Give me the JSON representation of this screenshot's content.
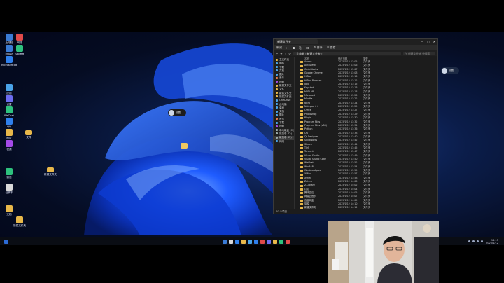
{
  "desktop": {
    "icons_left": [
      {
        "label": "此电脑"
      },
      {
        "label": "网络"
      },
      {
        "label": "回收站"
      },
      {
        "label": "控制面板"
      },
      {
        "label": "Microsoft Edge"
      },
      {
        "label": "应用"
      },
      {
        "label": "设置"
      },
      {
        "label": "WeChat"
      },
      {
        "label": "QQ"
      },
      {
        "label": "图片"
      },
      {
        "label": "视频"
      },
      {
        "label": "微信"
      },
      {
        "label": "记事本"
      },
      {
        "label": "文档"
      },
      {
        "label": "新建文件夹"
      }
    ],
    "folder_icons": [
      {
        "label": "文件"
      },
      {
        "label": "新建文件夹"
      },
      {
        "label": ""
      }
    ],
    "profile_badge": "设置",
    "right_badge": "设置"
  },
  "explorer": {
    "tab_title": "新建文件夹",
    "window_controls": [
      "—",
      "□",
      "✕"
    ],
    "toolbar": [
      "新建",
      "✂",
      "⧉",
      "⎘",
      "⌫",
      "⇅ 排序",
      "☰ 查看",
      "···"
    ],
    "breadcrumb": "› 此电脑 › 新建文件夹 ›",
    "search_placeholder": "在 新建文件夹 中搜索",
    "nav_items": [
      {
        "label": "主文件夹",
        "color": "#e8b84a"
      },
      {
        "label": "图库",
        "color": "#4aa3e8"
      },
      {
        "label": "下载",
        "color": "#4aa3e8"
      },
      {
        "label": "文档",
        "color": "#4aa3e8"
      },
      {
        "label": "图片",
        "color": "#4aa3e8"
      },
      {
        "label": "音乐",
        "color": "#e87a4a"
      },
      {
        "label": "视频",
        "color": "#a44ae8"
      },
      {
        "label": "新建文件夹",
        "color": "#e8b84a"
      },
      {
        "label": "文件",
        "color": "#e8b84a"
      },
      {
        "label": "新建文件夹",
        "color": "#e8b84a"
      },
      {
        "label": "新建文件夹",
        "color": "#e8b84a"
      },
      {
        "label": "OneDrive",
        "color": "#4aa3e8"
      },
      {
        "label": "此电脑",
        "color": "#4aa3e8"
      },
      {
        "label": "桌面",
        "color": "#4aa3e8"
      },
      {
        "label": "文档",
        "color": "#4aa3e8"
      },
      {
        "label": "图片",
        "color": "#4aa3e8"
      },
      {
        "label": "音乐",
        "color": "#e87a4a"
      },
      {
        "label": "下载",
        "color": "#4aa3e8"
      },
      {
        "label": "视频",
        "color": "#a44ae8"
      },
      {
        "label": "本地磁盘 (C:)",
        "color": "#9aa"
      },
      {
        "label": "新加卷 (D:)",
        "color": "#9aa"
      },
      {
        "label": "新加卷 (E:)",
        "color": "#9aa"
      },
      {
        "label": "网络",
        "color": "#4aa3e8"
      }
    ],
    "columns": [
      "名称",
      "修改日期",
      "类型"
    ],
    "files": [
      {
        "name": "Adobe",
        "date": "2025/1/12 13:05",
        "type": "文件夹"
      },
      {
        "name": "AutoDesk",
        "date": "2025/1/12 13:06",
        "type": "文件夹"
      },
      {
        "name": "CodeBlocks",
        "date": "2025/1/12 13:07",
        "type": "文件夹"
      },
      {
        "name": "Google Chrome",
        "date": "2025/1/12 13:08",
        "type": "文件夹"
      },
      {
        "name": "HiTool",
        "date": "2025/1/12 13:10",
        "type": "文件夹"
      },
      {
        "name": "HiTool Browser",
        "date": "2025/1/12 13:12",
        "type": "文件夹"
      },
      {
        "name": "Java",
        "date": "2025/1/12 13:15",
        "type": "文件夹"
      },
      {
        "name": "Keyshot",
        "date": "2025/1/12 13:16",
        "type": "文件夹"
      },
      {
        "name": "MATLAB",
        "date": "2025/1/12 13:18",
        "type": "文件夹"
      },
      {
        "name": "Microsoft",
        "date": "2025/1/12 13:20",
        "type": "文件夹"
      },
      {
        "name": "Mozilla",
        "date": "2025/1/12 13:22",
        "type": "文件夹"
      },
      {
        "name": "Nitro",
        "date": "2025/1/12 13:24",
        "type": "文件夹"
      },
      {
        "name": "Notepad++",
        "date": "2025/1/12 13:25",
        "type": "文件夹"
      },
      {
        "name": "Office",
        "date": "2025/1/12 13:27",
        "type": "文件夹"
      },
      {
        "name": "Photoshop",
        "date": "2025/1/12 13:29",
        "type": "文件夹"
      },
      {
        "name": "Plugin",
        "date": "2025/1/12 13:30",
        "type": "文件夹"
      },
      {
        "name": "Program Files",
        "date": "2025/1/12 13:32",
        "type": "文件夹"
      },
      {
        "name": "Program Files (x86)",
        "date": "2025/1/12 13:34",
        "type": "文件夹"
      },
      {
        "name": "Python",
        "date": "2025/1/12 13:36",
        "type": "文件夹"
      },
      {
        "name": "QQ",
        "date": "2025/1/12 13:38",
        "type": "文件夹"
      },
      {
        "name": "Qt Designer",
        "date": "2025/1/12 13:40",
        "type": "文件夹"
      },
      {
        "name": "SolidWorks",
        "date": "2025/1/12 13:42",
        "type": "文件夹"
      },
      {
        "name": "Steam",
        "date": "2025/1/12 13:44",
        "type": "文件夹"
      },
      {
        "name": "TIM",
        "date": "2025/1/12 13:45",
        "type": "文件夹"
      },
      {
        "name": "Tencent",
        "date": "2025/1/12 13:47",
        "type": "文件夹"
      },
      {
        "name": "Visual Studio",
        "date": "2025/1/12 13:49",
        "type": "文件夹"
      },
      {
        "name": "Visual Studio Code",
        "date": "2025/1/12 13:50",
        "type": "文件夹"
      },
      {
        "name": "WeChat",
        "date": "2025/1/12 13:52",
        "type": "文件夹"
      },
      {
        "name": "WinRAR",
        "date": "2025/1/12 13:54",
        "type": "文件夹"
      },
      {
        "name": "WindowsApps",
        "date": "2025/1/12 13:55",
        "type": "文件夹"
      },
      {
        "name": "XMind",
        "date": "2025/1/12 13:57",
        "type": "文件夹"
      },
      {
        "name": "Xshell",
        "date": "2025/1/12 13:58",
        "type": "文件夹"
      },
      {
        "name": "Zotero",
        "date": "2025/1/12 14:00",
        "type": "文件夹"
      },
      {
        "name": "Z-Library",
        "date": "2025/1/12 14:02",
        "type": "文件夹"
      },
      {
        "name": "钉钉",
        "date": "2025/1/12 14:04",
        "type": "文件夹"
      },
      {
        "name": "腾讯会议",
        "date": "2025/1/12 14:05",
        "type": "文件夹"
      },
      {
        "name": "网易云音乐",
        "date": "2025/1/12 14:07",
        "type": "文件夹"
      },
      {
        "name": "百度网盘",
        "date": "2025/1/12 14:09",
        "type": "文件夹"
      },
      {
        "name": "剪映",
        "date": "2025/1/12 14:10",
        "type": "文件夹"
      },
      {
        "name": "新建文件夹",
        "date": "2025/1/12 14:12",
        "type": "文件夹"
      }
    ],
    "status": "40 个项目"
  },
  "taskbar": {
    "app_colors": [
      "#3a7bd5",
      "#d9d9d9",
      "#2f80ed",
      "#e8b84a",
      "#4aa3e8",
      "#2f80ed",
      "#e04a4a",
      "#6c6cf0",
      "#e8b84a",
      "#2ec27e",
      "#e04a4a"
    ],
    "time": "14:15",
    "date": "2025/1/12"
  },
  "colors": {
    "accent": "#0a64ff",
    "folder": "#e8b84a"
  }
}
